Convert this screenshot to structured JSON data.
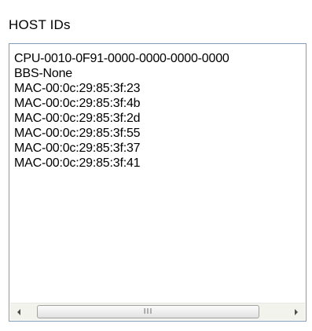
{
  "panel": {
    "title": "HOST IDs"
  },
  "host_ids": [
    "CPU-0010-0F91-0000-0000-0000-0000",
    "BBS-None",
    "MAC-00:0c:29:85:3f:23",
    "MAC-00:0c:29:85:3f:4b",
    "MAC-00:0c:29:85:3f:2d",
    "MAC-00:0c:29:85:3f:55",
    "MAC-00:0c:29:85:3f:37",
    "MAC-00:0c:29:85:3f:41"
  ],
  "scrollbar": {
    "left_icon": "arrow-left-icon",
    "right_icon": "arrow-right-icon",
    "grip_icon": "grip-icon",
    "grip_glyph": "III"
  },
  "colors": {
    "border": "#7f9db9",
    "scroll_track": "#f3f3ee"
  }
}
